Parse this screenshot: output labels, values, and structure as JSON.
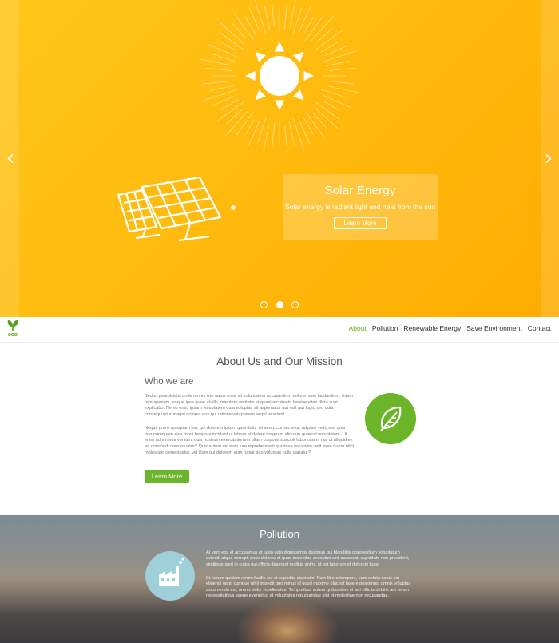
{
  "hero": {
    "prev_arrow": "‹",
    "next_arrow": "›",
    "caption": {
      "title": "Solar Energy",
      "text": "Solar energy is radiant light and heat from the sun",
      "button": "Learn More"
    },
    "slide_count": 3,
    "active_slide": 2
  },
  "nav": {
    "logo_text": "eco",
    "links": [
      "About",
      "Pollution",
      "Renewable Energy",
      "Save Environment",
      "Contact"
    ],
    "active": "About"
  },
  "about": {
    "title": "About Us and Our Mission",
    "subtitle": "Who we are",
    "paragraph1": "Sed ut perspiciatis unde omnis iste natus error sit voluptatem accusantium doloremque laudantium, totam rem aperiam, eaque ipsa quae ab illo inventore veritatis et quasi architecto beatae vitae dicta sunt explicabo. Nemo enim ipsam voluptatem quia voluptas sit aspernatur aut odit aut fugit, sed quia consequuntur magni dolores eos qui ratione voluptatem sequi nesciunt.",
    "paragraph2": "Neque porro quisquam est, qui dolorem ipsum quia dolor sit amet, consectetur, adipisci velit, sed quia non numquam eius modi tempora incidunt ut labore et dolore magnam aliquam quaerat voluptatem. Ut enim ad minima veniam, quis nostrum exercitationem ullam corporis suscipit laboriosam, nisi ut aliquid ex ea commodi consequatur? Quis autem vel eum iure reprehenderit qui in ea voluptate velit esse quam nihil molestiae consequatur, vel illum qui dolorem eum fugiat quo voluptas nulla pariatur?",
    "button": "Learn More",
    "accent_color": "#6cb529"
  },
  "pollution": {
    "title": "Pollution",
    "paragraph1": "At vero eos et accusamus et iusto odio dignissimos ducimus qui blanditiis praesentium voluptatum deleniti atque corrupti quos dolores et quas molestias excepturi sint occaecati cupiditate non provident, similique sunt in culpa qui officia deserunt mollitia animi, id est laborum et dolorum fuga.",
    "paragraph2": "Et harum quidem rerum facilis est et expedita distinctio. Nam libero tempore, cum soluta nobis est eligendi optio cumque nihil impedit quo minus id quod maxime placeat facere possimus, omnis voluptas assumenda est, omnis dolor repellendus. Temporibus autem quibusdam et aut officiis debitis aut rerum necessitatibus saepe eveniet ut et voluptates repudiandae sint et molestiae non recusandae.",
    "icon_color": "#9fcfd8"
  }
}
